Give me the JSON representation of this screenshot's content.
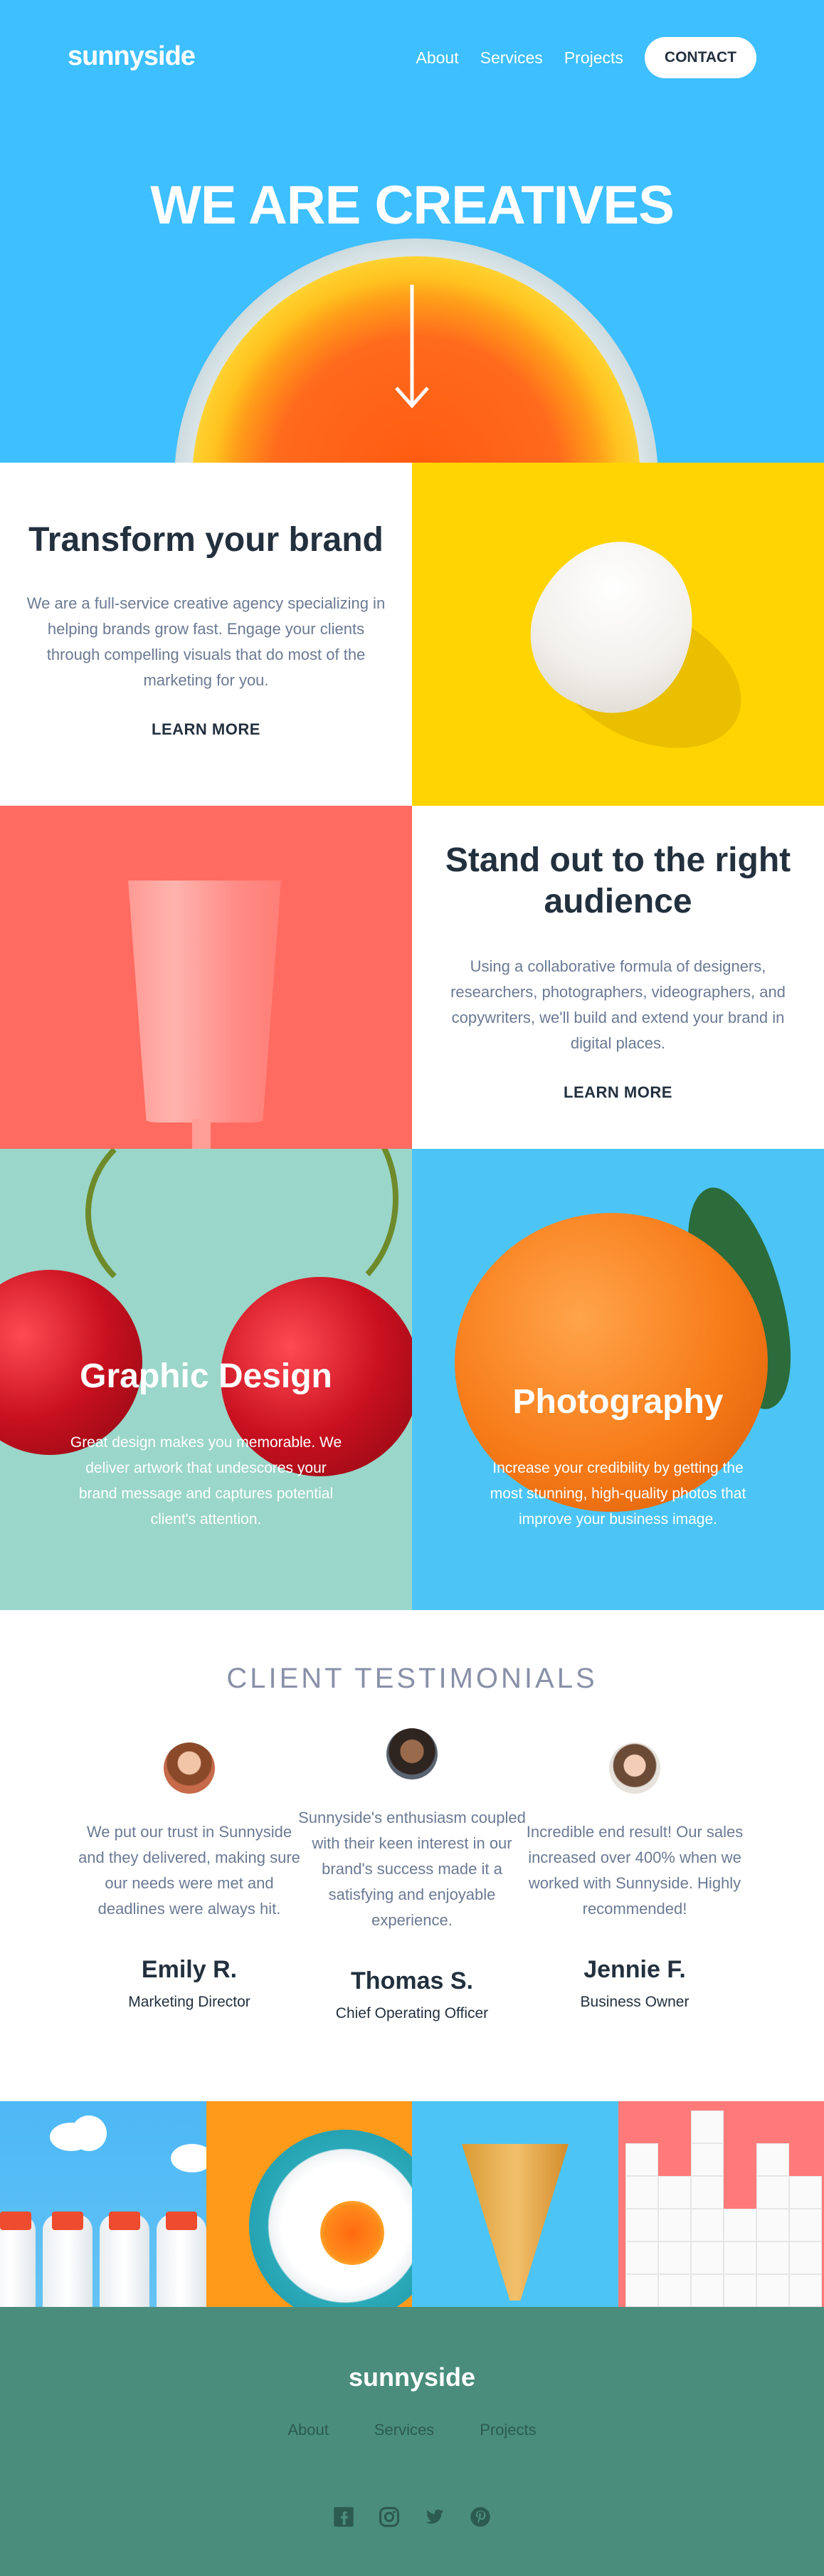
{
  "header": {
    "logo": "sunnyside",
    "nav": [
      "About",
      "Services",
      "Projects"
    ],
    "contact_label": "CONTACT",
    "hero_title": "WE ARE CREATIVES"
  },
  "transform": {
    "title": "Transform your brand",
    "body": "We are a full-service creative agency specializing in helping brands grow fast. Engage your clients through compelling visuals that do most of the marketing for you.",
    "cta": "LEARN MORE"
  },
  "standout": {
    "title": "Stand out to the right audience",
    "body": "Using a collaborative formula of designers, researchers, photographers, videographers, and copywriters, we'll build and extend your brand in digital places.",
    "cta": "LEARN MORE"
  },
  "services": [
    {
      "title": "Graphic Design",
      "body": "Great design makes you memorable. We deliver artwork that undescores your brand message and captures potential client's attention."
    },
    {
      "title": "Photography",
      "body": "Increase your credibility by getting the most stunning, high-quality photos that improve your business image."
    }
  ],
  "testimonials": {
    "heading": "CLIENT TESTIMONIALS",
    "items": [
      {
        "quote": "We put our trust in Sunnyside and they delivered, making sure our needs were met and deadlines were always hit.",
        "name": "Emily R.",
        "role": "Marketing Director"
      },
      {
        "quote": "Sunnyside's enthusiasm coupled with their keen interest in our brand's success made it a satisfying and enjoyable experience.",
        "name": "Thomas S.",
        "role": "Chief Operating Officer"
      },
      {
        "quote": "Incredible end result! Our sales increased over 400% when we worked with Sunnyside. Highly recommended!",
        "name": "Jennie F.",
        "role": "Business Owner"
      }
    ]
  },
  "footer": {
    "logo": "sunnyside",
    "nav": [
      "About",
      "Services",
      "Projects"
    ],
    "social_icons": [
      "facebook-icon",
      "instagram-icon",
      "twitter-icon",
      "pinterest-icon"
    ]
  },
  "colors": {
    "hero_blue": "#3ebfff",
    "accent_yellow": "#ffd400",
    "coral": "#ff6b60",
    "footer_green": "#4a8d7c",
    "dark_text": "#23303e"
  }
}
